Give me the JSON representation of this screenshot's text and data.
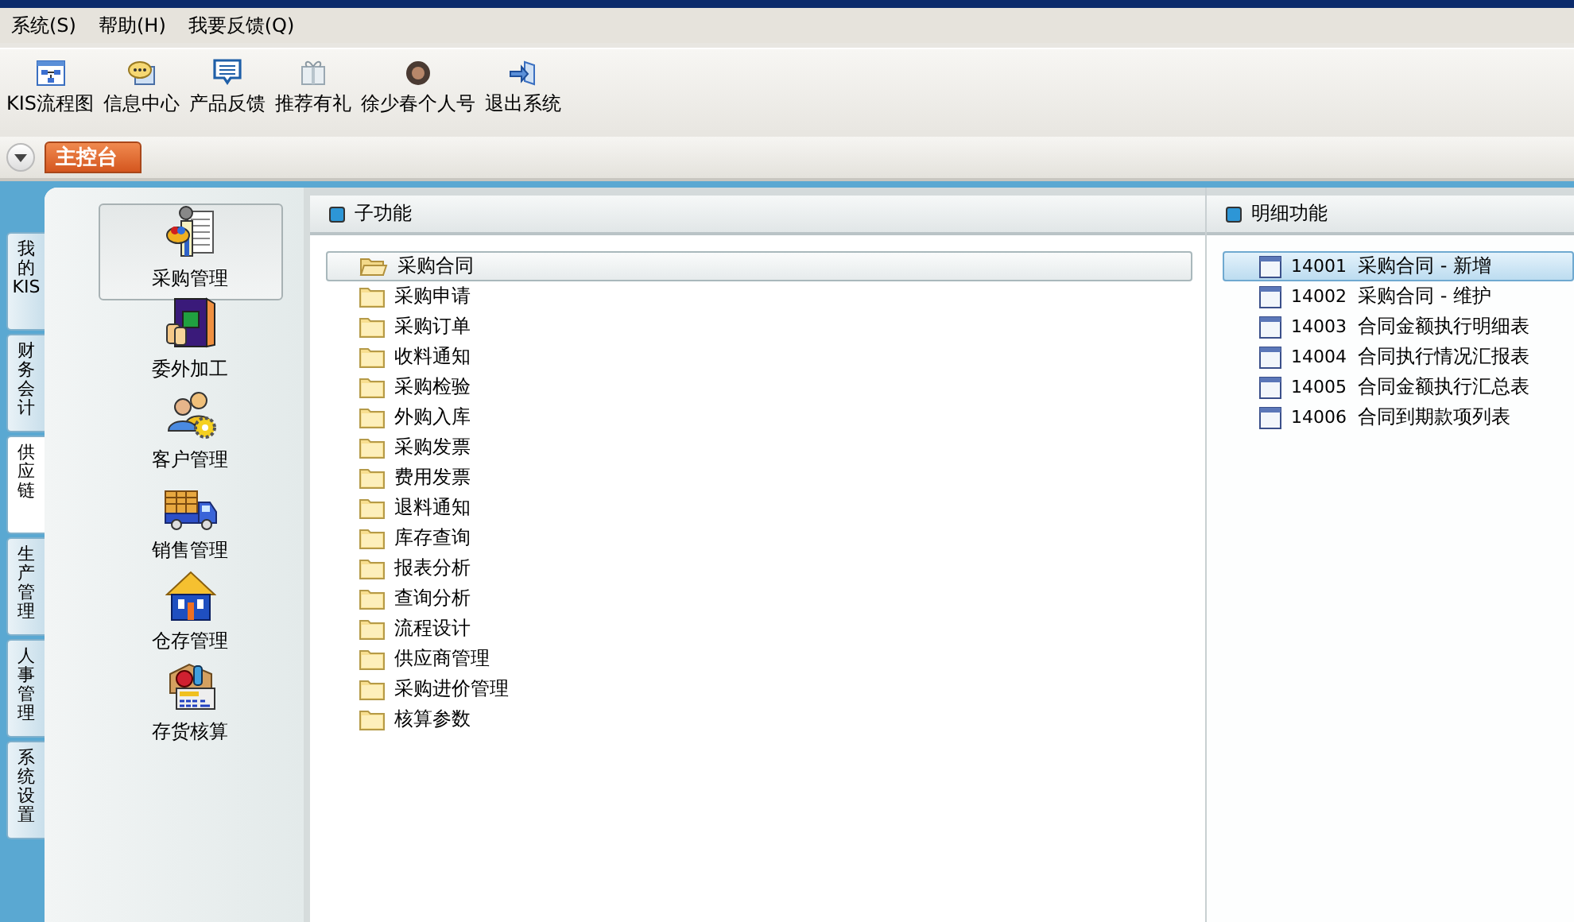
{
  "menu": [
    {
      "label": "系统(S)"
    },
    {
      "label": "帮助(H)"
    },
    {
      "label": "我要反馈(Q)"
    }
  ],
  "toolbar": [
    {
      "label": "KIS流程图"
    },
    {
      "label": "信息中心"
    },
    {
      "label": "产品反馈"
    },
    {
      "label": "推荐有礼"
    },
    {
      "label": "徐少春个人号"
    },
    {
      "label": "退出系统"
    }
  ],
  "tabs": [
    {
      "label": "主控台",
      "selected": true
    }
  ],
  "side_tabs": [
    {
      "label": "我的KIS",
      "selected": false
    },
    {
      "label": "财务会计",
      "selected": false
    },
    {
      "label": "供应链",
      "selected": true
    },
    {
      "label": "生产管理",
      "selected": false
    },
    {
      "label": "人事管理",
      "selected": false
    },
    {
      "label": "系统设置",
      "selected": false
    }
  ],
  "modules": [
    {
      "label": "采购管理",
      "selected": true
    },
    {
      "label": "委外加工",
      "selected": false
    },
    {
      "label": "客户管理",
      "selected": false
    },
    {
      "label": "销售管理",
      "selected": false
    },
    {
      "label": "仓存管理",
      "selected": false
    },
    {
      "label": "存货核算",
      "selected": false
    }
  ],
  "sub_panel": {
    "title": "子功能",
    "items": [
      {
        "label": "采购合同",
        "selected": true
      },
      {
        "label": "采购申请",
        "selected": false
      },
      {
        "label": "采购订单",
        "selected": false
      },
      {
        "label": "收料通知",
        "selected": false
      },
      {
        "label": "采购检验",
        "selected": false
      },
      {
        "label": "外购入库",
        "selected": false
      },
      {
        "label": "采购发票",
        "selected": false
      },
      {
        "label": "费用发票",
        "selected": false
      },
      {
        "label": "退料通知",
        "selected": false
      },
      {
        "label": "库存查询",
        "selected": false
      },
      {
        "label": "报表分析",
        "selected": false
      },
      {
        "label": "查询分析",
        "selected": false
      },
      {
        "label": "流程设计",
        "selected": false
      },
      {
        "label": "供应商管理",
        "selected": false
      },
      {
        "label": "采购进价管理",
        "selected": false
      },
      {
        "label": "核算参数",
        "selected": false
      }
    ]
  },
  "detail_panel": {
    "title": "明细功能",
    "items": [
      {
        "code": "14001",
        "name": "采购合同 - 新增",
        "selected": true
      },
      {
        "code": "14002",
        "name": "采购合同 - 维护",
        "selected": false
      },
      {
        "code": "14003",
        "name": "合同金额执行明细表",
        "selected": false
      },
      {
        "code": "14004",
        "name": "合同执行情况汇报表",
        "selected": false
      },
      {
        "code": "14005",
        "name": "合同金额执行汇总表",
        "selected": false
      },
      {
        "code": "14006",
        "name": "合同到期款项列表",
        "selected": false
      }
    ]
  }
}
